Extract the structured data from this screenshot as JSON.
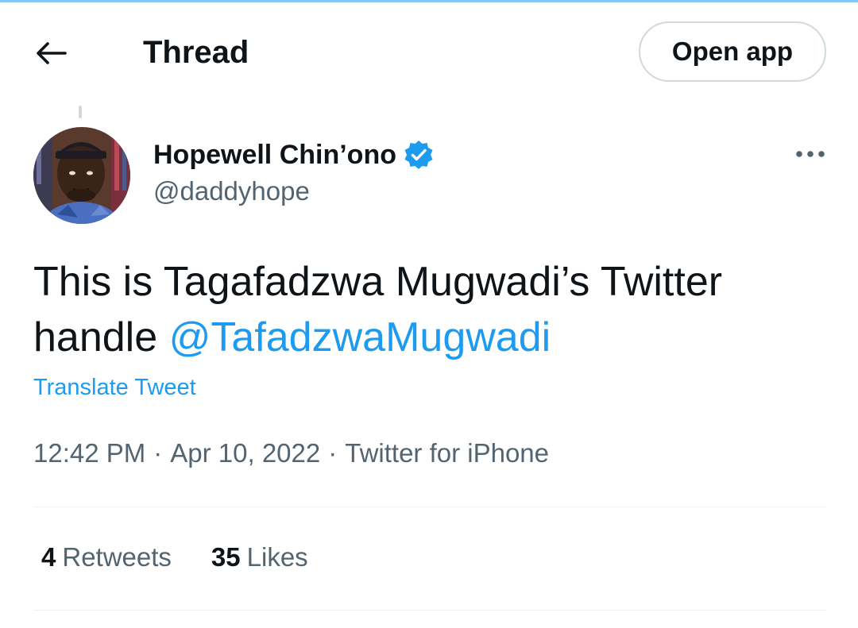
{
  "header": {
    "title": "Thread",
    "open_app_label": "Open app",
    "back_icon": "arrow-left-icon"
  },
  "tweet": {
    "author": {
      "display_name": "Hopewell Chin’ono",
      "handle": "@daddyhope",
      "verified": true
    },
    "text_before": "This is Tagafadzwa Mugwadi’s Twitter handle ",
    "mention": "@TafadzwaMugwadi",
    "translate_label": "Translate Tweet",
    "time": "12:42 PM",
    "date": "Apr 10, 2022",
    "source": "Twitter for iPhone",
    "separator": "·",
    "retweets_count": "4",
    "retweets_label": "Retweets",
    "likes_count": "35",
    "likes_label": "Likes"
  },
  "colors": {
    "accent": "#1d9bf0",
    "text_primary": "#0f1419",
    "text_secondary": "#536471",
    "border": "#cfd9de"
  }
}
